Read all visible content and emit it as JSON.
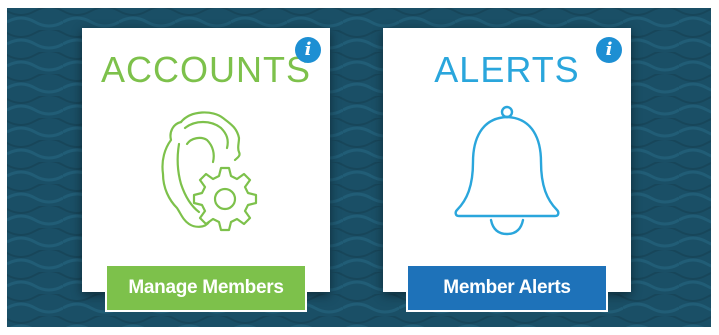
{
  "cards": {
    "accounts": {
      "title": "ACCOUNTS",
      "info": "i",
      "icon": "user-gear-icon",
      "button_label": "Manage Members",
      "accent": "#7dc14b"
    },
    "alerts": {
      "title": "ALERTS",
      "info": "i",
      "icon": "bell-icon",
      "button_label": "Member Alerts",
      "accent": "#2aa6dc",
      "button_color": "#1e72b9"
    }
  },
  "colors": {
    "background": "#1a4f66",
    "info_badge": "#1d8fd3"
  }
}
